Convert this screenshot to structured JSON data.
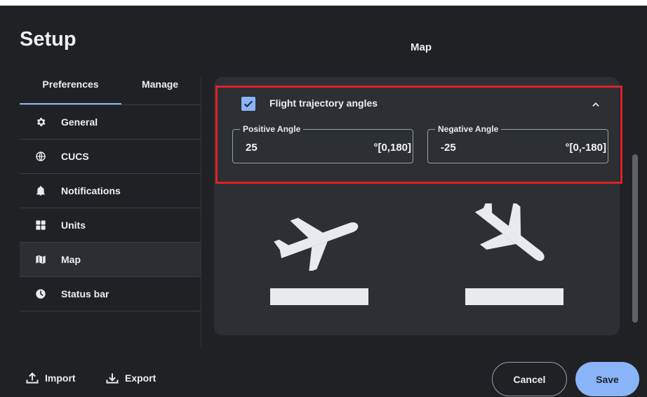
{
  "title": "Setup",
  "section_title": "Map",
  "tabs": [
    {
      "label": "Preferences",
      "active": true
    },
    {
      "label": "Manage",
      "active": false
    }
  ],
  "nav": [
    {
      "label": "General",
      "icon": "gear-icon"
    },
    {
      "label": "CUCS",
      "icon": "globe-icon"
    },
    {
      "label": "Notifications",
      "icon": "bell-icon"
    },
    {
      "label": "Units",
      "icon": "grid-icon"
    },
    {
      "label": "Map",
      "icon": "map-icon",
      "active": true
    },
    {
      "label": "Status bar",
      "icon": "clock-icon"
    }
  ],
  "trajectory": {
    "checked": true,
    "label": "Flight trajectory angles",
    "collapse_icon": "chevron-up-icon",
    "positive": {
      "label": "Positive Angle",
      "value": "25",
      "range": "°[0,180]"
    },
    "negative": {
      "label": "Negative Angle",
      "value": "-25",
      "range": "°[0,-180]"
    }
  },
  "illustrations": [
    "takeoff-icon",
    "landing-icon"
  ],
  "footer": {
    "import_label": "Import",
    "export_label": "Export",
    "cancel_label": "Cancel",
    "save_label": "Save"
  },
  "colors": {
    "background": "#1f2124",
    "card": "#2c2f34",
    "accent": "#8ab4f8",
    "highlight": "#e0202a",
    "text": "#eceff1"
  }
}
